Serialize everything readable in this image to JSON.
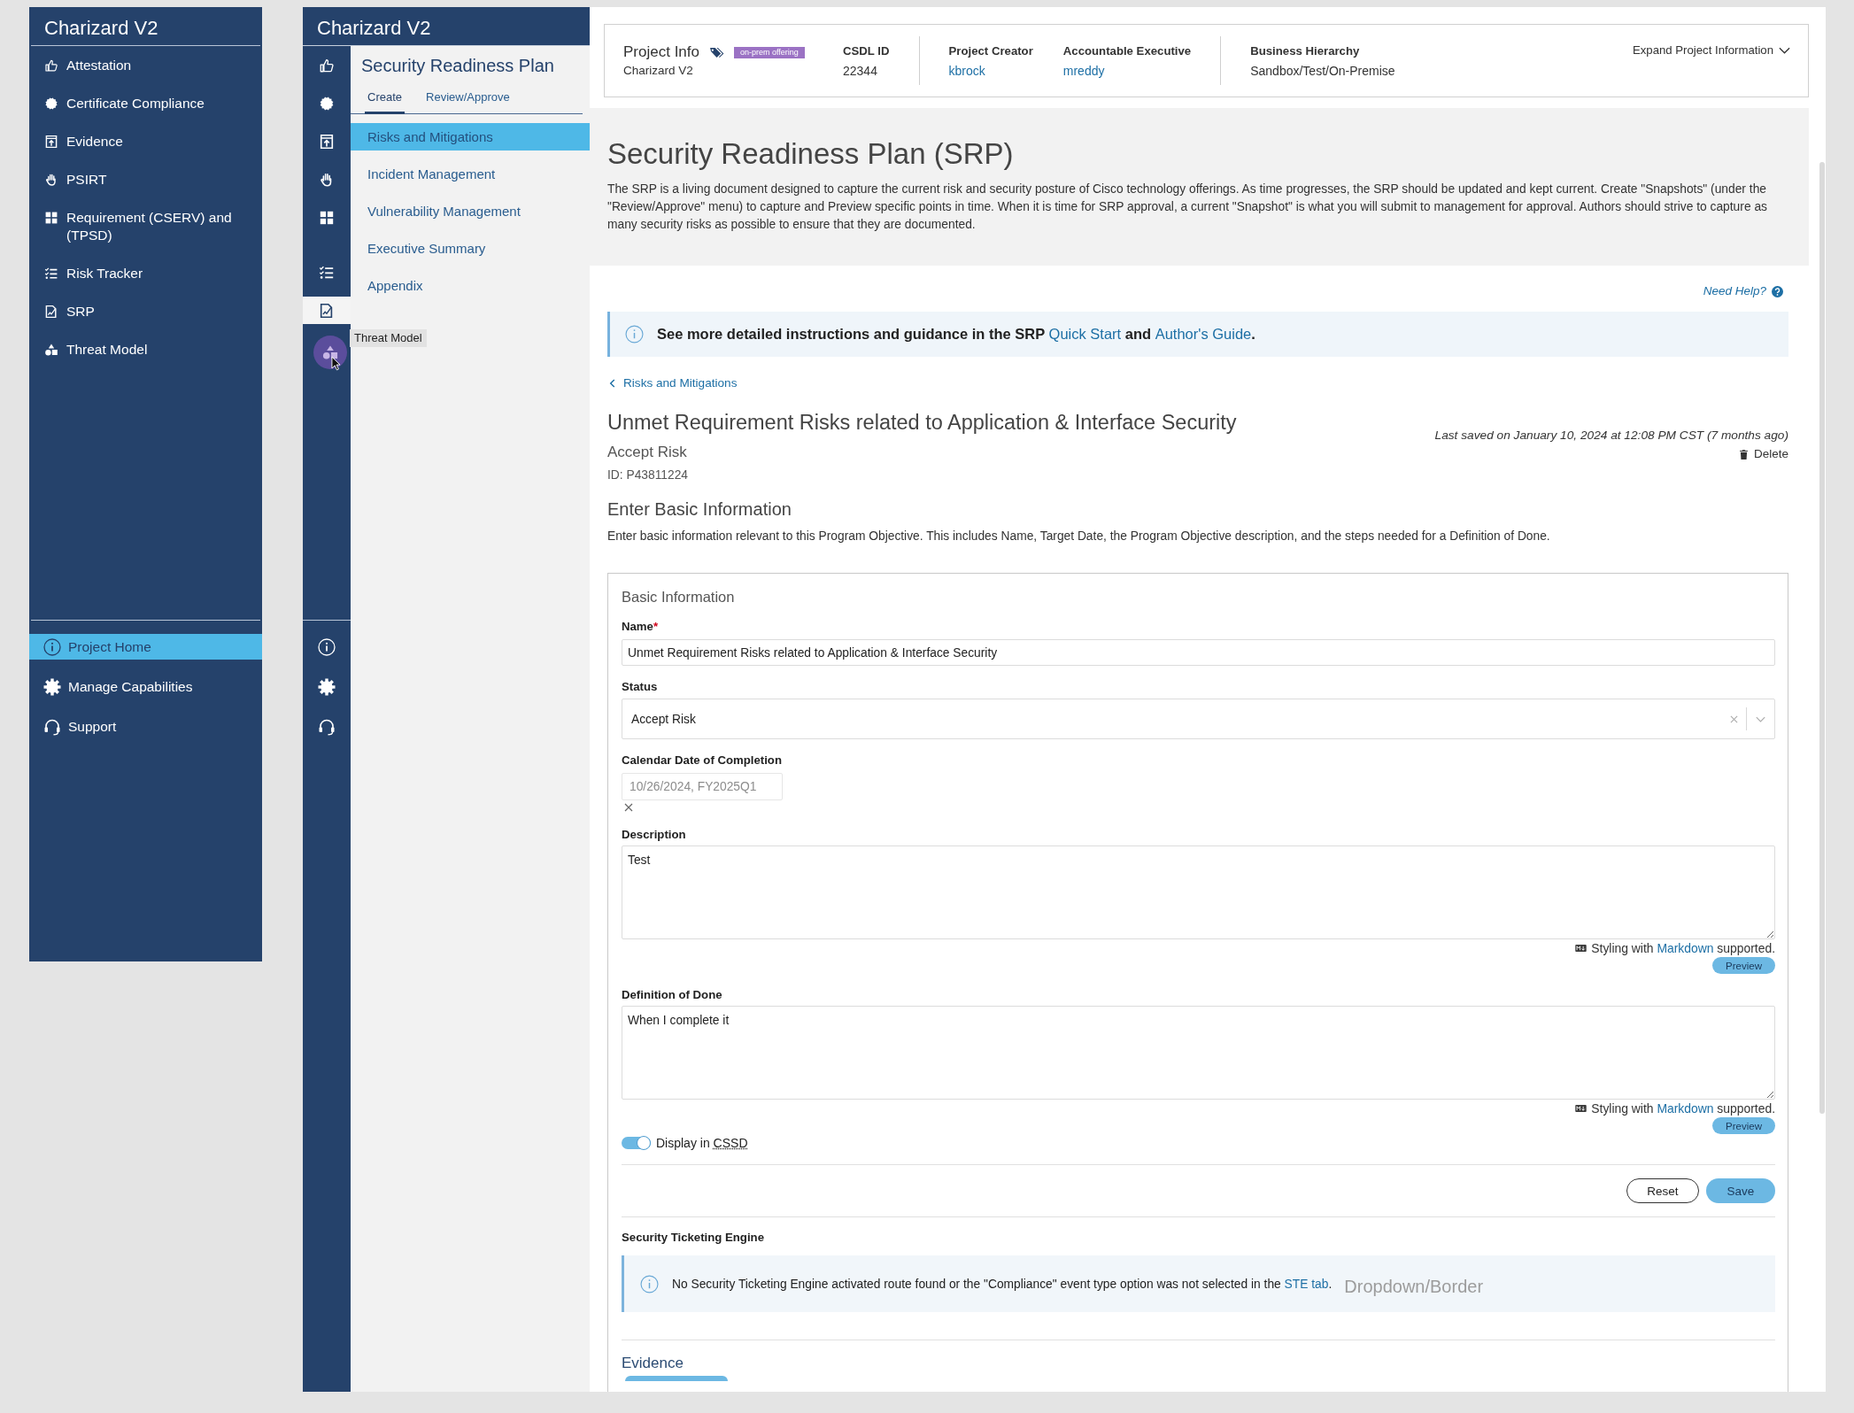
{
  "sidebar": {
    "title": "Charizard V2",
    "items": [
      {
        "label": "Attestation",
        "selected": false
      },
      {
        "label": "Certificate Compliance",
        "selected": false
      },
      {
        "label": "Evidence",
        "selected": false
      },
      {
        "label": "PSIRT",
        "selected": false
      },
      {
        "label": "Requirement (CSERV) and (TPSD)",
        "selected": false
      },
      {
        "label": "Risk Tracker",
        "selected": false
      },
      {
        "label": "SRP",
        "selected": false
      },
      {
        "label": "Threat Model",
        "selected": false
      }
    ],
    "footer_items": [
      {
        "label": "Project Home",
        "selected": true
      },
      {
        "label": "Manage Capabilities",
        "selected": false
      },
      {
        "label": "Support",
        "selected": false
      }
    ]
  },
  "rail": {
    "title": "Charizard V2",
    "items": [
      {
        "selected": false,
        "hovered": false
      },
      {
        "selected": false,
        "hovered": false
      },
      {
        "selected": false,
        "hovered": false
      },
      {
        "selected": false,
        "hovered": false
      },
      {
        "selected": false,
        "hovered": false
      },
      {
        "selected": false,
        "hovered": false
      },
      {
        "selected": true,
        "hovered": false
      },
      {
        "selected": false,
        "hovered": true
      }
    ],
    "tooltip": "Threat Model"
  },
  "nav": {
    "title": "Security Readiness Plan",
    "tabs": [
      {
        "label": "Create",
        "selected": true
      },
      {
        "label": "Review/Approve",
        "selected": false
      }
    ],
    "items": [
      {
        "label": "Risks and Mitigations",
        "selected": true
      },
      {
        "label": "Incident Management",
        "selected": false
      },
      {
        "label": "Vulnerability Management",
        "selected": false
      },
      {
        "label": "Executive Summary",
        "selected": false
      },
      {
        "label": "Appendix",
        "selected": false
      }
    ]
  },
  "project_info": {
    "title": "Project Info",
    "name": "Charizard V2",
    "badge": "on-prem offering",
    "groups": [
      {
        "fields": [
          {
            "label": "CSDL ID",
            "value": "22344",
            "kind": "text"
          }
        ]
      },
      {
        "fields": [
          {
            "label": "Project Creator",
            "value": "kbrock",
            "kind": "link"
          },
          {
            "label": "Accountable Executive",
            "value": "mreddy",
            "kind": "link"
          }
        ]
      },
      {
        "fields": [
          {
            "label": "Business Hierarchy",
            "value": "Sandbox/Test/On-Premise",
            "kind": "text"
          }
        ]
      }
    ],
    "expand_label": "Expand Project Information"
  },
  "intro": {
    "title": "Security Readiness Plan (SRP)",
    "description": "The SRP is a living document designed to capture the current risk and security posture of Cisco technology offerings. As time progresses, the SRP should be updated and kept current. Create \"Snapshots\" (under the \"Review/Approve\" menu) to capture and Preview specific points in time. When it is time for SRP approval, a current \"Snapshot\" is what you will submit to management for approval. Authors should strive to capture as many security risks as possible to ensure that they are documented."
  },
  "help_link": "Need Help?",
  "guidance": [
    {
      "kind": "text",
      "text": "See more detailed instructions and guidance in the SRP "
    },
    {
      "kind": "link",
      "text": "Quick Start"
    },
    {
      "kind": "text",
      "text": " and "
    },
    {
      "kind": "link",
      "text": "Author's Guide"
    },
    {
      "kind": "text",
      "text": "."
    }
  ],
  "back_link": "Risks and Mitigations",
  "risk": {
    "title": "Unmet Requirement Risks related to Application & Interface Security",
    "status": "Accept Risk",
    "id": "ID: P43811224",
    "last_saved": "Last saved on January 10, 2024 at 12:08 PM CST (7 months ago)",
    "delete_label": "Delete"
  },
  "section": {
    "heading": "Enter Basic Information",
    "description": "Enter basic information relevant to this Program Objective. This includes Name, Target Date, the Program Objective description, and the steps needed for a Definition of Done."
  },
  "form": {
    "title": "Basic Information",
    "fields": [
      {
        "kind": "text",
        "label": "Name",
        "required_mark": "*",
        "value": "Unmet Requirement Risks related to Application & Interface Security"
      },
      {
        "kind": "select",
        "label": "Status",
        "value": "Accept Risk"
      },
      {
        "kind": "date",
        "label": "Calendar Date of Completion",
        "placeholder": "10/26/2024, FY2025Q1"
      },
      {
        "kind": "textarea",
        "label": "Description",
        "value": "Test",
        "hint": [
          {
            "kind": "text",
            "text": "Styling with "
          },
          {
            "kind": "link",
            "text": "Markdown"
          },
          {
            "kind": "text",
            "text": " supported."
          }
        ],
        "preview_label": "Preview"
      },
      {
        "kind": "textarea",
        "label": "Definition of Done",
        "value": "When I complete it",
        "hint": [
          {
            "kind": "text",
            "text": "Styling with "
          },
          {
            "kind": "link",
            "text": "Markdown"
          },
          {
            "kind": "text",
            "text": " supported."
          }
        ],
        "preview_label": "Preview"
      }
    ],
    "toggle": {
      "label": "Display in",
      "abbr": "CSSD",
      "on": true
    },
    "actions": [
      {
        "label": "Reset",
        "kind": "secondary"
      },
      {
        "label": "Save",
        "kind": "primary"
      }
    ]
  },
  "ste": {
    "heading": "Security Ticketing Engine",
    "message": [
      {
        "kind": "text",
        "text": "No Security Ticketing Engine activated route found or the \"Compliance\" event type option was not selected in the "
      },
      {
        "kind": "link",
        "text": "STE tab"
      },
      {
        "kind": "text",
        "text": "."
      }
    ]
  },
  "overlay_label": "Dropdown/Border",
  "evidence": {
    "heading": "Evidence"
  }
}
